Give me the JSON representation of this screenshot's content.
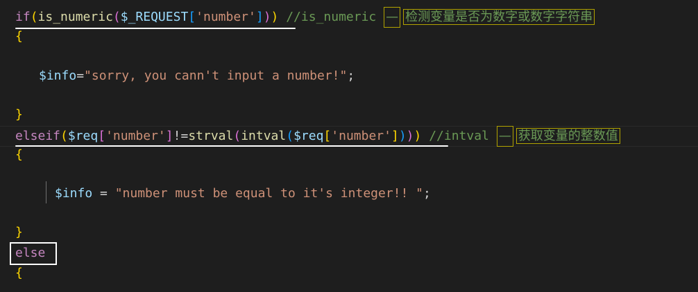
{
  "code": {
    "line1": {
      "kw_if": "if",
      "p_open": "(",
      "fn_is_numeric": "is_numeric",
      "p2_open": "(",
      "var_request": "$_REQUEST",
      "br_open": "[",
      "str_number": "'number'",
      "br_close": "]",
      "p2_close": ")",
      "p_close": ")",
      "comment": "//is_numeric",
      "dash": "—",
      "comment_cn": "检测变量是否为数字或数字字符串"
    },
    "line2": {
      "brace": "{"
    },
    "line3": {
      "var_info": "$info",
      "eq": "=",
      "str": "\"sorry, you cann't input a number!\"",
      "semi": ";"
    },
    "line4": {
      "brace": "}"
    },
    "line5": {
      "kw_elseif": "elseif",
      "p_open": "(",
      "var_req": "$req",
      "br_open": "[",
      "str_number": "'number'",
      "br_close": "]",
      "op_neq": "!=",
      "fn_strval": "strval",
      "p2_open": "(",
      "fn_intval": "intval",
      "p3_open": "(",
      "var_req2": "$req",
      "br2_open": "[",
      "str_number2": "'number'",
      "br2_close": "]",
      "p3_close": ")",
      "p2_close": ")",
      "p_close": ")",
      "comment": "//intval",
      "dash": "—",
      "comment_cn": "获取变量的整数值"
    },
    "line6": {
      "brace": "{"
    },
    "line7": {
      "var_info": "$info",
      "eq": " = ",
      "str": "\"number must be equal to it's integer!! \"",
      "semi": ";"
    },
    "line8": {
      "brace": "}"
    },
    "line9": {
      "kw_else": "else"
    },
    "line10": {
      "brace": "{"
    }
  },
  "colors": {
    "background": "#1e1e1e",
    "keyword": "#c586c0",
    "function": "#dcdcaa",
    "variable": "#9cdcfe",
    "string": "#ce9178",
    "comment": "#6a9955",
    "bracket_level1": "#ffd700",
    "bracket_level2": "#da70d6",
    "bracket_level3": "#179fff",
    "annotation": "#ffffff"
  }
}
